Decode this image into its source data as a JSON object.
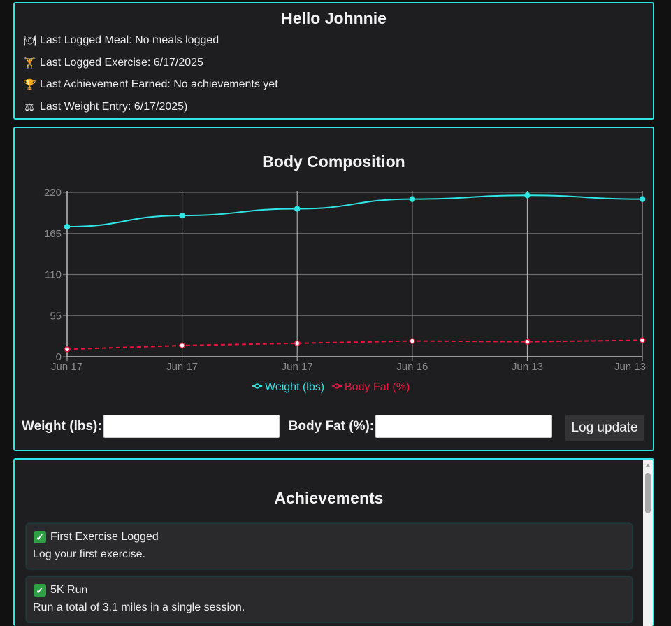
{
  "welcome": {
    "title": "Hello Johnnie",
    "rows": [
      {
        "icon": "plate-icon",
        "glyph": "🍽",
        "text": "Last Logged Meal: No meals logged"
      },
      {
        "icon": "dumbbell-icon",
        "glyph": "🏋",
        "text": "Last Logged Exercise: 6/17/2025"
      },
      {
        "icon": "trophy-icon",
        "glyph": "🏆",
        "text": "Last Achievement Earned: No achievements yet"
      },
      {
        "icon": "scale-icon",
        "glyph": "⚖",
        "text": "Last Weight Entry: 6/17/2025)"
      }
    ]
  },
  "chart_panel": {
    "title": "Body Composition",
    "weight_label": "Weight (lbs):",
    "bodyfat_label": "Body Fat (%):",
    "weight_value": "",
    "bodyfat_value": "",
    "log_button": "Log update"
  },
  "chart_data": {
    "type": "line",
    "title": "Body Composition",
    "categories": [
      "Jun 17",
      "Jun 17",
      "Jun 17",
      "Jun 16",
      "Jun 13",
      "Jun 13"
    ],
    "ylim": [
      0,
      220
    ],
    "yticks": [
      0,
      55,
      110,
      165,
      220
    ],
    "grid": true,
    "legend": "bottom",
    "series": [
      {
        "name": "Weight (lbs)",
        "color": "#2fe6e6",
        "dashed": false,
        "values": [
          174,
          189,
          198,
          211,
          216,
          211
        ]
      },
      {
        "name": "Body Fat (%)",
        "color": "#e8163f",
        "dashed": false,
        "values": [
          10,
          15,
          18,
          21,
          20,
          22
        ]
      }
    ]
  },
  "achievements": {
    "title": "Achievements",
    "items": [
      {
        "title": "First Exercise Logged",
        "desc": "Log your first exercise."
      },
      {
        "title": "5K Run",
        "desc": "Run a total of 3.1 miles in a single session."
      }
    ]
  },
  "colors": {
    "accent": "#2fe6e6",
    "bodyfat": "#e8163f",
    "background": "#111111",
    "panel": "#1e1e20"
  }
}
